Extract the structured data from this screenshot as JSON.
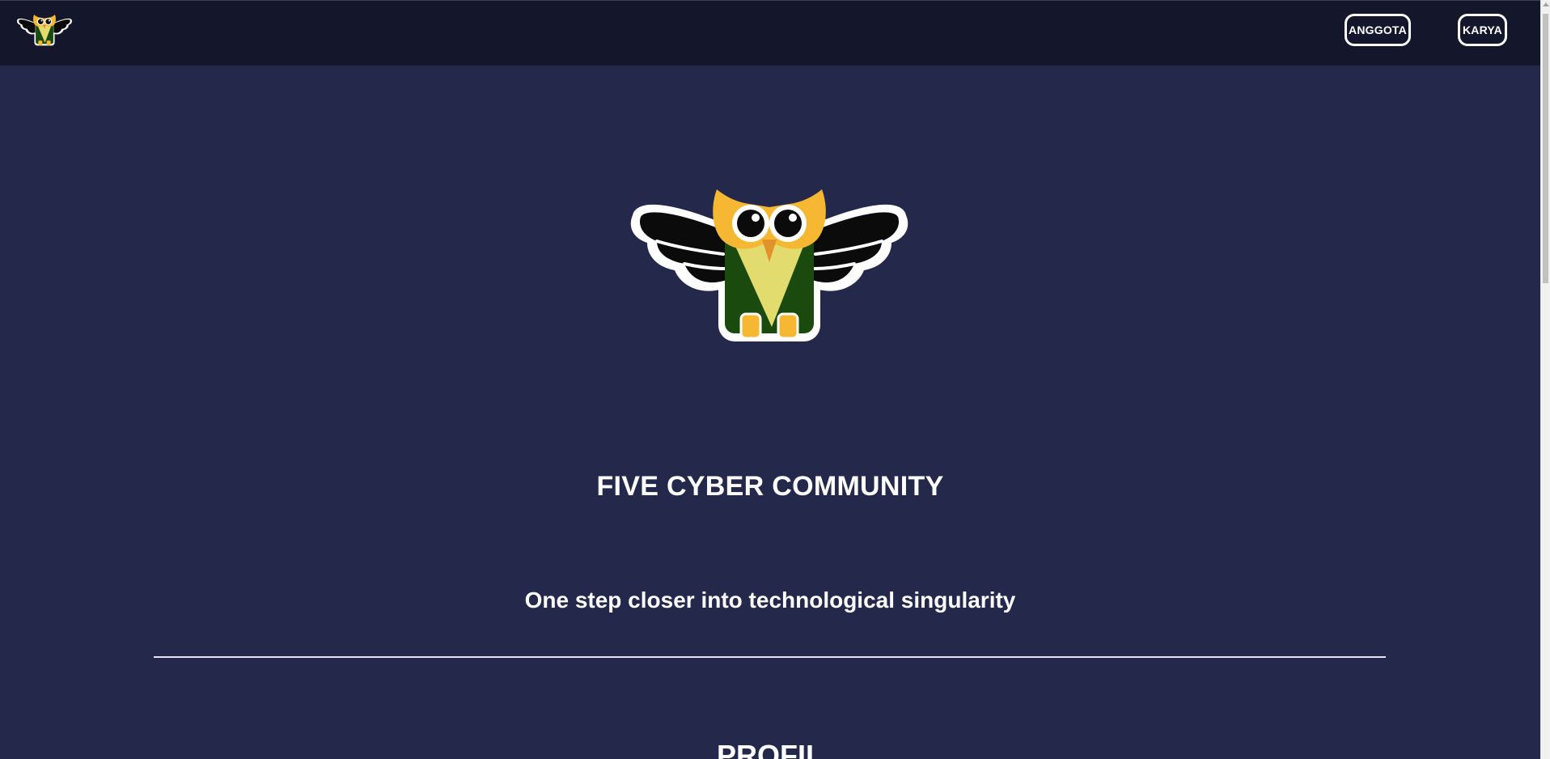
{
  "navbar": {
    "logo_icon": "owl-logo-icon",
    "links": [
      {
        "label": "ANGGOTA"
      },
      {
        "label": "KARYA"
      }
    ]
  },
  "hero": {
    "logo_icon": "owl-logo-icon",
    "title": "FIVE CYBER COMMUNITY",
    "tagline": "One step closer into technological singularity"
  },
  "section": {
    "heading": "PROFIL"
  },
  "colors": {
    "page_background": "#24284a",
    "navbar_background": "#14172b",
    "text": "#ffffff",
    "owl_body": "#1a4a0e",
    "owl_chest": "#e2db6e",
    "owl_head": "#f6b733",
    "owl_wings": "#0a0a0a"
  }
}
